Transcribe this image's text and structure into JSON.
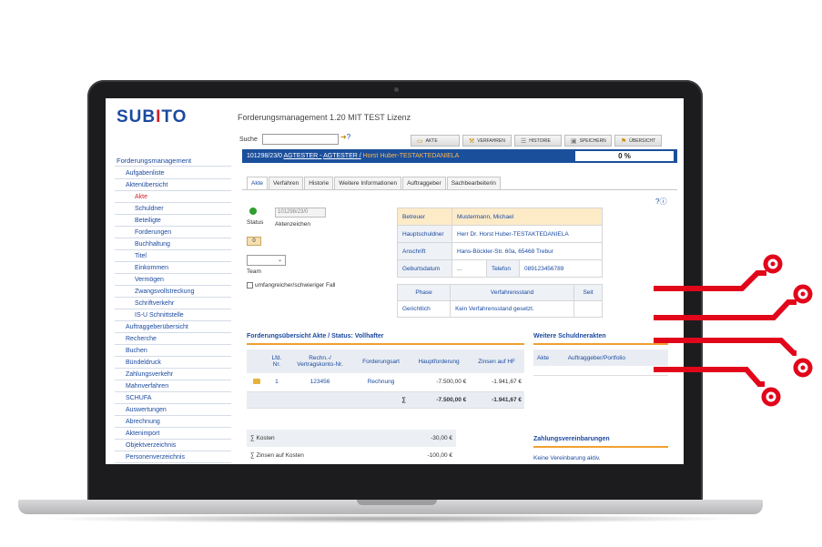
{
  "app": {
    "logo_left": "SUB",
    "logo_accent": "I",
    "logo_right": "TO",
    "title": "Forderungsmanagement 1.20 MIT TEST Lizenz"
  },
  "search": {
    "label": "Suche",
    "value": ""
  },
  "toolbar": {
    "akte": "AKTE",
    "verfahren": "VERFAHREN",
    "historie": "HISTORIE",
    "speichern": "SPEICHERN",
    "uebersicht": "ÜBERSICHT"
  },
  "sidebar": {
    "items": [
      {
        "label": "Forderungsmanagement",
        "level": 0
      },
      {
        "label": "Aufgabenliste",
        "level": 1
      },
      {
        "label": "Aktenübersicht",
        "level": 1
      },
      {
        "label": "Akte",
        "level": 2
      },
      {
        "label": "Schuldner",
        "level": 2
      },
      {
        "label": "Beteiligte",
        "level": 2
      },
      {
        "label": "Forderungen",
        "level": 2
      },
      {
        "label": "Buchhaltung",
        "level": 2
      },
      {
        "label": "Titel",
        "level": 2
      },
      {
        "label": "Einkommen",
        "level": 2
      },
      {
        "label": "Vermögen",
        "level": 2
      },
      {
        "label": "Zwangsvollstreckung",
        "level": 2
      },
      {
        "label": "Schriftverkehr",
        "level": 2
      },
      {
        "label": "IS-U Schnittstelle",
        "level": 2
      },
      {
        "label": "Auftraggeberübersicht",
        "level": 1
      },
      {
        "label": "Recherche",
        "level": 1
      },
      {
        "label": "Buchen",
        "level": 1
      },
      {
        "label": "Bündeldruck",
        "level": 1
      },
      {
        "label": "Zahlungsverkehr",
        "level": 1
      },
      {
        "label": "Mahnverfahren",
        "level": 1
      },
      {
        "label": "SCHUFA",
        "level": 1
      },
      {
        "label": "Auswertungen",
        "level": 1
      },
      {
        "label": "Abrechnung",
        "level": 1
      },
      {
        "label": "Aktenimport",
        "level": 1
      },
      {
        "label": "Objektverzeichnis",
        "level": 1
      },
      {
        "label": "Personenverzeichnis",
        "level": 1
      }
    ]
  },
  "case_bar": {
    "case_number": "101298/23/0",
    "client1": "AGTESTER -",
    "client2": "AGTESTER /",
    "debtor": "Horst Huber-TESTAKTEDANIELA",
    "progress": "0 %"
  },
  "tabs": [
    "Akte",
    "Verfahren",
    "Historie",
    "Weitere Informationen",
    "Auftraggeber",
    "Sachbearbeiterin"
  ],
  "detail": {
    "status_label": "Status",
    "aktenzeichen_value": "101298/23/0",
    "aktenzeichen_label": "Aktenzeichen",
    "badge": "0",
    "team_label": "Team",
    "difficult_case_label": "umfangreicher/schwieriger Fall"
  },
  "info": {
    "betreuer_label": "Betreuer",
    "betreuer_value": "Mustermann, Michael",
    "hauptschuldner_label": "Hauptschuldner",
    "hauptschuldner_value": "Herr Dr. Horst Huber-TESTAKTEDANIELA",
    "anschrift_label": "Anschrift",
    "anschrift_value": "Hans-Böckler-Str. 60a, 65468 Trebur",
    "geburtsdatum_label": "Geburtsdatum",
    "geburtsdatum_value": "...",
    "telefon_label": "Telefon",
    "telefon_value": "089123456789"
  },
  "phase": {
    "col_phase": "Phase",
    "col_stand": "Verfahrensstand",
    "col_seit": "Seit",
    "phase_value": "Gerichtlich",
    "stand_value": "Kein Verfahrensstand gesetzt."
  },
  "claims": {
    "title": "Forderungsübersicht Akte / Status: Vollhafter",
    "headers": {
      "lfd": "Lfd.",
      "lfd2": "Nr.",
      "rechn": "Rechn.-/",
      "rechn2": "Vertragskonto-Nr.",
      "art": "Forderungsart",
      "haupt": "Hauptforderung",
      "zinsen": "Zinsen auf HF"
    },
    "row": {
      "nr": "1",
      "konto": "123456",
      "art": "Rechnung",
      "haupt": "-7.500,00 €",
      "zinsen": "-1.941,67 €"
    },
    "sum": {
      "symbol": "∑",
      "haupt": "-7.500,00 €",
      "zinsen": "-1.941,67 €"
    }
  },
  "other_files": {
    "title": "Weitere Schuldnerakten",
    "col_akte": "Akte",
    "col_auftraggeber": "Auftraggeber/Portfolio"
  },
  "costs": {
    "kosten_label": "∑ Kosten",
    "kosten_value": "-30,00 €",
    "zinsen_label": "∑ Zinsen auf Kosten",
    "zinsen_value": "-100,00 €"
  },
  "agreements": {
    "title": "Zahlungsvereinbarungen",
    "empty": "Keine Vereinbarung aktiv."
  },
  "colors": {
    "brand_blue": "#1b4aa0",
    "accent_red": "#d4212a",
    "circuit_red": "#e2061b",
    "bar_blue": "#1a4f9c"
  }
}
